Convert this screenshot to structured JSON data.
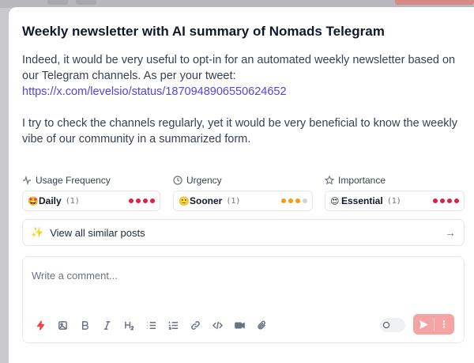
{
  "post": {
    "title": "Weekly newsletter with AI summary of Nomads Telegram",
    "paragraph1": "Indeed, it would be very useful to opt-in for an automated weekly newsletter based on our Telegram channels. As per your tweet:",
    "link": "https://x.com/levelsio/status/1870948906550624652",
    "paragraph2": "I try to check the channels regularly, yet it would be very beneficial to know the weekly vibe of our community in a summarized form."
  },
  "metrics": [
    {
      "label": "Usage Frequency",
      "icon": "activity-icon",
      "emoji": "🤩",
      "value": "Daily",
      "count": "(1)",
      "level": 4,
      "max": 4,
      "color": "#e11d48"
    },
    {
      "label": "Urgency",
      "icon": "clock-icon",
      "emoji": "🙂",
      "value": "Sooner",
      "count": "(1)",
      "level": 3,
      "max": 4,
      "color": "#f59e0b"
    },
    {
      "label": "Importance",
      "icon": "star-icon",
      "emoji": "😍",
      "value": "Essential",
      "count": "(1)",
      "level": 4,
      "max": 4,
      "color": "#e11d48"
    }
  ],
  "similar": {
    "label": "View all similar posts",
    "icon": "sparkles-icon",
    "arrow": "→"
  },
  "composer": {
    "placeholder": "Write a comment...",
    "toolbar": [
      "lightning-icon",
      "image-icon",
      "bold-icon",
      "italic-icon",
      "heading-icon",
      "bullet-list-icon",
      "numbered-list-icon",
      "link-icon",
      "code-icon",
      "video-icon",
      "attachment-icon"
    ],
    "send_icon": "send-icon",
    "more_icon": "more-vertical-icon"
  },
  "colors": {
    "accent": "#4f46e5",
    "send": "#f6a3a3",
    "danger": "#ef4444"
  }
}
